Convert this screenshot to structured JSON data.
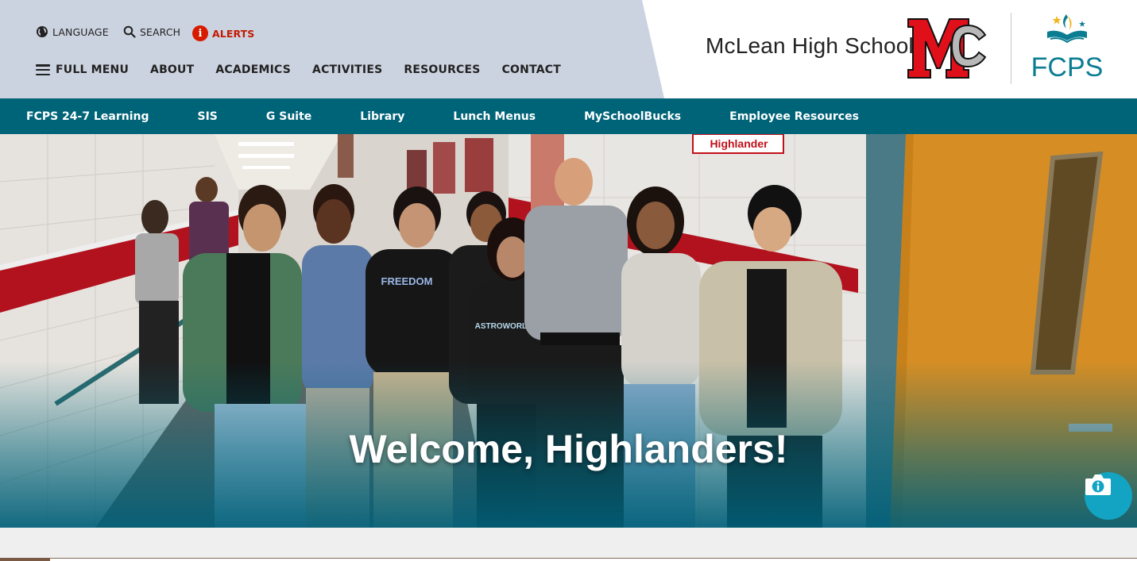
{
  "utility_nav": {
    "language": "LANGUAGE",
    "search": "SEARCH",
    "alerts": "ALERTS",
    "alerts_icon_glyph": "i"
  },
  "main_nav": {
    "items": [
      "FULL MENU",
      "ABOUT",
      "ACADEMICS",
      "ACTIVITIES",
      "RESOURCES",
      "CONTACT"
    ]
  },
  "branding": {
    "school_name": "McLean High School",
    "fcps_text": "FCPS"
  },
  "quick_links": [
    "FCPS 24-7 Learning",
    "SIS",
    "G Suite",
    "Library",
    "Lunch Menus",
    "MySchoolBucks",
    "Employee Resources"
  ],
  "hero": {
    "title": "Welcome, Highlanders!",
    "photo_banner_text": "Highlander",
    "shirt_text_1": "FREEDOM",
    "shirt_text_2": "ASTROWORLD"
  },
  "colors": {
    "header_gray": "#ccd3e0",
    "teal_bar": "#006479",
    "alert_red": "#d71a00",
    "mc_red": "#e0101b",
    "fcps_teal": "#0b7d92",
    "info_button": "#13a4c4"
  },
  "icons": [
    "globe-icon",
    "search-icon",
    "alert-icon",
    "hamburger-icon",
    "camera-info-icon"
  ]
}
